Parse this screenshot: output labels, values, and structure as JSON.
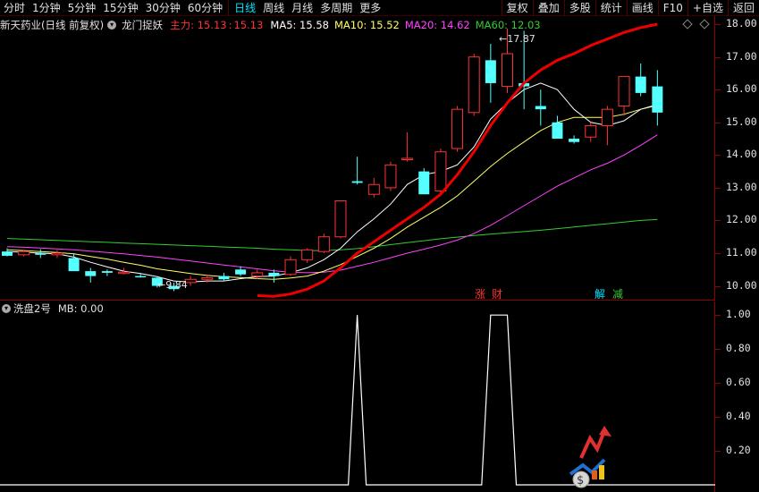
{
  "toolbar": {
    "left_tabs": [
      "分时",
      "1分钟",
      "5分钟",
      "15分钟",
      "30分钟",
      "60分钟",
      "日线",
      "周线",
      "月线",
      "多周期",
      "更多"
    ],
    "active_tab": "日线",
    "right_buttons": [
      "复权",
      "叠加",
      "多股",
      "统计",
      "画线",
      "F10",
      "+自选",
      "返回"
    ]
  },
  "info": {
    "stock_name": "新天药业",
    "period": "(日线 前复权)",
    "indicator_name": "龙门捉妖",
    "zhuli_label": "主力: 15.13",
    "zhuli_value2": "15.13",
    "ma5": "MA5: 15.58",
    "ma10": "MA10: 15.52",
    "ma20": "MA20: 14.62",
    "ma60": "MA60: 12.03"
  },
  "price_axis": [
    "18.00",
    "17.00",
    "16.00",
    "15.00",
    "14.00",
    "13.00",
    "12.00",
    "11.00",
    "10.00"
  ],
  "annotations": {
    "high": "17.87",
    "low": "9.84"
  },
  "signals": [
    {
      "text": "涨",
      "color": "#ff3333"
    },
    {
      "text": "财",
      "color": "#ff3333"
    },
    {
      "text": "解",
      "color": "#00e5ff"
    },
    {
      "text": "减",
      "color": "#33cc33"
    }
  ],
  "sub": {
    "name": "洗盘2号",
    "mb": "MB: 0.00",
    "axis": [
      "1.00",
      "0.80",
      "0.60",
      "0.40",
      "0.20"
    ]
  },
  "colors": {
    "up": "#ff3333",
    "down": "#54ffff",
    "ma5": "#ffffff",
    "ma10": "#ffff66",
    "ma20": "#ff44ff",
    "ma60": "#33cc33",
    "zhuli": "#ee0000"
  },
  "chart_data": {
    "type": "candlestick",
    "price_range": [
      9.55,
      18.25
    ],
    "candles": [
      {
        "o": 11.05,
        "h": 11.15,
        "l": 10.9,
        "c": 10.92
      },
      {
        "o": 10.95,
        "h": 11.1,
        "l": 10.9,
        "c": 11.05
      },
      {
        "o": 11.0,
        "h": 11.12,
        "l": 10.85,
        "c": 10.95
      },
      {
        "o": 10.95,
        "h": 11.1,
        "l": 10.85,
        "c": 11.0
      },
      {
        "o": 10.85,
        "h": 11.0,
        "l": 10.45,
        "c": 10.45
      },
      {
        "o": 10.45,
        "h": 10.55,
        "l": 10.1,
        "c": 10.3
      },
      {
        "o": 10.45,
        "h": 10.5,
        "l": 10.3,
        "c": 10.4
      },
      {
        "o": 10.4,
        "h": 10.55,
        "l": 10.35,
        "c": 10.42
      },
      {
        "o": 10.3,
        "h": 10.4,
        "l": 10.25,
        "c": 10.28
      },
      {
        "o": 10.25,
        "h": 10.3,
        "l": 9.95,
        "c": 10.0
      },
      {
        "o": 10.0,
        "h": 10.1,
        "l": 9.84,
        "c": 9.9
      },
      {
        "o": 10.1,
        "h": 10.3,
        "l": 10.0,
        "c": 10.2
      },
      {
        "o": 10.2,
        "h": 10.35,
        "l": 10.1,
        "c": 10.25
      },
      {
        "o": 10.3,
        "h": 10.4,
        "l": 10.15,
        "c": 10.2
      },
      {
        "o": 10.5,
        "h": 10.6,
        "l": 10.3,
        "c": 10.35
      },
      {
        "o": 10.3,
        "h": 10.5,
        "l": 10.2,
        "c": 10.4
      },
      {
        "o": 10.4,
        "h": 10.5,
        "l": 10.1,
        "c": 10.3
      },
      {
        "o": 10.35,
        "h": 10.9,
        "l": 10.3,
        "c": 10.8
      },
      {
        "o": 10.8,
        "h": 11.15,
        "l": 10.7,
        "c": 11.1
      },
      {
        "o": 11.05,
        "h": 11.6,
        "l": 11.0,
        "c": 11.5
      },
      {
        "o": 11.5,
        "h": 12.6,
        "l": 11.45,
        "c": 12.6
      },
      {
        "o": 13.2,
        "h": 13.95,
        "l": 13.1,
        "c": 13.15
      },
      {
        "o": 12.8,
        "h": 13.3,
        "l": 12.7,
        "c": 13.1
      },
      {
        "o": 13.0,
        "h": 13.8,
        "l": 12.9,
        "c": 13.7
      },
      {
        "o": 13.9,
        "h": 14.7,
        "l": 13.8,
        "c": 13.9
      },
      {
        "o": 13.5,
        "h": 13.6,
        "l": 12.8,
        "c": 12.8
      },
      {
        "o": 12.9,
        "h": 14.2,
        "l": 12.85,
        "c": 14.1
      },
      {
        "o": 14.2,
        "h": 15.5,
        "l": 14.1,
        "c": 15.4
      },
      {
        "o": 15.3,
        "h": 17.1,
        "l": 15.2,
        "c": 17.0
      },
      {
        "o": 16.9,
        "h": 17.4,
        "l": 15.6,
        "c": 16.2
      },
      {
        "o": 16.1,
        "h": 17.87,
        "l": 15.9,
        "c": 17.1
      },
      {
        "o": 16.2,
        "h": 17.8,
        "l": 15.4,
        "c": 16.1
      },
      {
        "o": 15.5,
        "h": 16.0,
        "l": 14.9,
        "c": 15.4
      },
      {
        "o": 15.0,
        "h": 15.2,
        "l": 14.5,
        "c": 14.5
      },
      {
        "o": 14.5,
        "h": 14.6,
        "l": 14.35,
        "c": 14.4
      },
      {
        "o": 14.55,
        "h": 15.0,
        "l": 14.4,
        "c": 14.9
      },
      {
        "o": 14.9,
        "h": 15.5,
        "l": 14.3,
        "c": 15.4
      },
      {
        "o": 15.5,
        "h": 16.4,
        "l": 15.2,
        "c": 16.4
      },
      {
        "o": 16.4,
        "h": 16.8,
        "l": 15.8,
        "c": 15.9
      },
      {
        "o": 16.1,
        "h": 16.6,
        "l": 14.9,
        "c": 15.3
      }
    ],
    "lines": {
      "ma5": [
        11.05,
        11.03,
        11.0,
        10.98,
        10.88,
        10.72,
        10.58,
        10.45,
        10.38,
        10.28,
        10.15,
        10.12,
        10.15,
        10.15,
        10.22,
        10.28,
        10.3,
        10.4,
        10.55,
        10.8,
        11.15,
        11.65,
        12.05,
        12.5,
        13.1,
        13.4,
        13.5,
        13.7,
        14.25,
        15.1,
        15.6,
        16.0,
        16.2,
        16.0,
        15.4,
        15.0,
        14.9,
        15.05,
        15.4,
        15.55
      ],
      "ma10": [
        11.1,
        11.08,
        11.05,
        11.02,
        10.98,
        10.9,
        10.82,
        10.72,
        10.63,
        10.52,
        10.45,
        10.38,
        10.32,
        10.28,
        10.25,
        10.22,
        10.2,
        10.24,
        10.3,
        10.45,
        10.65,
        10.9,
        11.15,
        11.45,
        11.8,
        12.1,
        12.4,
        12.75,
        13.2,
        13.65,
        14.05,
        14.4,
        14.75,
        15.0,
        15.15,
        15.15,
        15.15,
        15.25,
        15.4,
        15.52
      ],
      "ma20": [
        11.2,
        11.18,
        11.16,
        11.13,
        11.1,
        11.06,
        11.02,
        10.98,
        10.93,
        10.88,
        10.82,
        10.76,
        10.7,
        10.64,
        10.58,
        10.52,
        10.46,
        10.42,
        10.4,
        10.42,
        10.48,
        10.6,
        10.72,
        10.86,
        11.0,
        11.12,
        11.25,
        11.4,
        11.6,
        11.85,
        12.15,
        12.45,
        12.75,
        13.05,
        13.3,
        13.55,
        13.75,
        14.0,
        14.3,
        14.62
      ],
      "ma60": [
        11.45,
        11.43,
        11.41,
        11.39,
        11.37,
        11.35,
        11.33,
        11.31,
        11.29,
        11.27,
        11.25,
        11.23,
        11.21,
        11.19,
        11.17,
        11.15,
        11.12,
        11.1,
        11.08,
        11.08,
        11.1,
        11.14,
        11.2,
        11.26,
        11.32,
        11.38,
        11.44,
        11.49,
        11.54,
        11.58,
        11.62,
        11.66,
        11.7,
        11.75,
        11.8,
        11.85,
        11.9,
        11.95,
        12.0,
        12.03
      ],
      "zhuli": [
        null,
        null,
        null,
        null,
        null,
        null,
        null,
        null,
        null,
        null,
        null,
        null,
        null,
        null,
        null,
        9.7,
        9.68,
        9.75,
        9.9,
        10.15,
        10.55,
        11.0,
        11.35,
        11.7,
        12.05,
        12.4,
        12.8,
        13.4,
        14.1,
        14.9,
        15.6,
        16.2,
        16.6,
        16.9,
        17.1,
        17.35,
        17.55,
        17.75,
        17.9,
        18.0
      ]
    },
    "sub_series": [
      0,
      0,
      0,
      0,
      0,
      0,
      0,
      0,
      0,
      0,
      0,
      0,
      0,
      0,
      0,
      0,
      0,
      0,
      0,
      0,
      0,
      1,
      0,
      0,
      0,
      0,
      0,
      0,
      0,
      1,
      1,
      0,
      0,
      0,
      0,
      0,
      0,
      0,
      0,
      0
    ],
    "sub_range": [
      0,
      1.08
    ]
  }
}
